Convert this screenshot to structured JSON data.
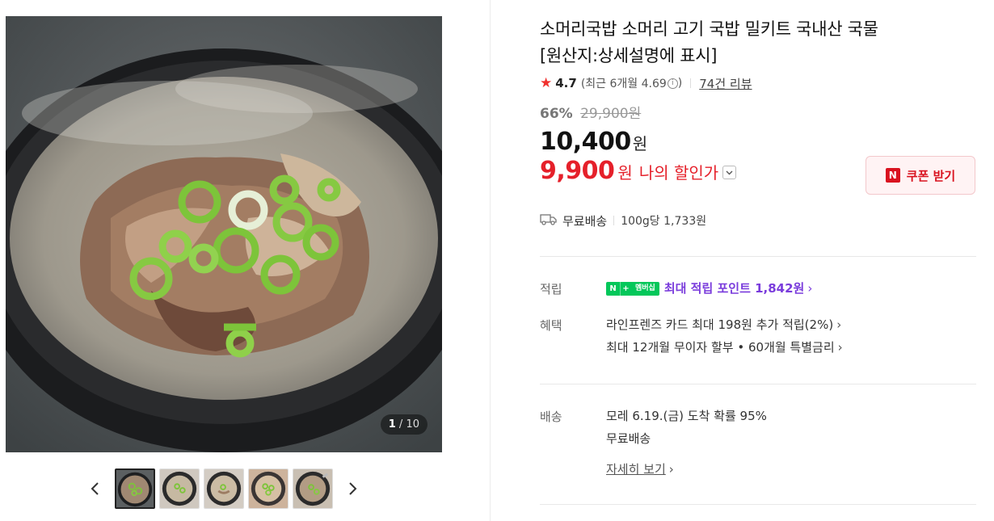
{
  "gallery": {
    "counter_current": "1",
    "counter_total": "10",
    "prev_icon": "chevron-left-icon",
    "next_icon": "chevron-right-icon",
    "thumbnail_count": 5
  },
  "product": {
    "title_line1": "소머리국밥 소머리 고기 국밥 밀키트 국내산 국물",
    "title_line2": "[원산지:상세설명에 표시]",
    "rating": "4.7",
    "rating_recent": "(최근 6개월 4.69",
    "rating_recent_close": ")",
    "review_link": "74건 리뷰",
    "discount_pct": "66%",
    "original_price": "29,900원",
    "price": "10,400",
    "price_unit": "원",
    "my_price": "9,900",
    "my_price_unit": "원",
    "my_price_label": "나의 할인가",
    "coupon_label": "쿠폰 받기",
    "coupon_icon_text": "N",
    "shipping": "무료배송",
    "unit_price": "100g당 1,733원"
  },
  "benefits": {
    "points_label": "적립",
    "membership_badge_n": "N",
    "membership_badge_plus": "+",
    "membership_badge_text": "멤버십",
    "points_text": "최대 적립 포인트 1,842원",
    "benefit_label": "혜택",
    "benefit_line1": "라인프렌즈 카드 최대 198원 추가 적립(2%)",
    "benefit_line2": "최대 12개월 무이자 할부 • 60개월 특별금리",
    "delivery_label": "배송",
    "delivery_line1": "모레 6.19.(금) 도착 확률 95%",
    "delivery_line2": "무료배송",
    "delivery_detail_link": "자세히 보기"
  },
  "colors": {
    "sale_red": "#e5202a",
    "membership_purple": "#7a3cdc",
    "naver_green": "#03c75a"
  }
}
